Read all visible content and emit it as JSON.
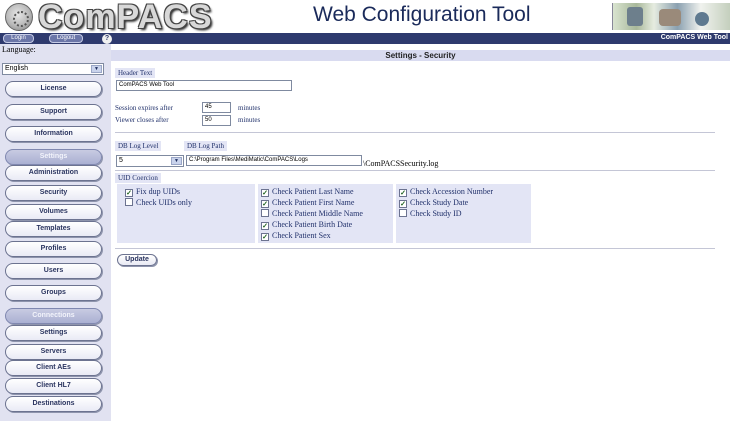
{
  "header": {
    "logo_text": "ComPACS",
    "title": "Web Configuration Tool"
  },
  "topbar": {
    "login_label": "Login",
    "logout_label": "Logout",
    "help_label": "?",
    "brand": "ComPACS Web Tool"
  },
  "sidebar": {
    "language_label": "Language:",
    "language_value": "English",
    "items": [
      {
        "label": "License",
        "group": false
      },
      {
        "label": "Support",
        "group": false
      },
      {
        "label": "Information",
        "group": false
      },
      {
        "label": "Settings",
        "group": true
      },
      {
        "label": "Administration",
        "group": false
      },
      {
        "label": "Security",
        "group": false
      },
      {
        "label": "Volumes",
        "group": false
      },
      {
        "label": "Templates",
        "group": false
      },
      {
        "label": "Profiles",
        "group": false
      },
      {
        "label": "Users",
        "group": false
      },
      {
        "label": "Groups",
        "group": false
      },
      {
        "label": "Connections",
        "group": true
      },
      {
        "label": "Settings",
        "group": false
      },
      {
        "label": "Servers",
        "group": false
      },
      {
        "label": "Client AEs",
        "group": false
      },
      {
        "label": "Client HL7",
        "group": false
      },
      {
        "label": "Destinations",
        "group": false
      }
    ]
  },
  "main": {
    "section_title": "Settings - Security",
    "header_text_label": "Header Text",
    "header_text_value": "ComPACS Web Tool",
    "session_label": "Session expires after",
    "session_value": "45",
    "session_unit": "minutes",
    "viewer_label": "Viewer closes after",
    "viewer_value": "50",
    "viewer_unit": "minutes",
    "db_log_level_label": "DB Log Level",
    "db_log_level_value": "5",
    "db_log_path_label": "DB Log Path",
    "db_log_path_value": "C:\\Program Files\\MediMatic\\ComPACS\\Logs",
    "db_log_suffix": "\\ComPACSSecurity.log",
    "uid_coercion_label": "UID Coercion",
    "checkboxes": [
      {
        "label": "Fix dup UIDs",
        "checked": true
      },
      {
        "label": "Check UIDs only",
        "checked": false
      },
      {
        "label": "Check Patient Last Name",
        "checked": true
      },
      {
        "label": "Check Patient First Name",
        "checked": true
      },
      {
        "label": "Check Patient Middle Name",
        "checked": false
      },
      {
        "label": "Check Patient Birth Date",
        "checked": true
      },
      {
        "label": "Check Patient Sex",
        "checked": true
      },
      {
        "label": "Check Accession Number",
        "checked": true
      },
      {
        "label": "Check Study Date",
        "checked": true
      },
      {
        "label": "Check Study ID",
        "checked": false
      }
    ],
    "update_label": "Update"
  },
  "colors": {
    "topbar": "#2e3a6e",
    "sidebar": "#e1e2f1",
    "section_bar": "#d9dbf0",
    "label_text": "#20306a"
  }
}
